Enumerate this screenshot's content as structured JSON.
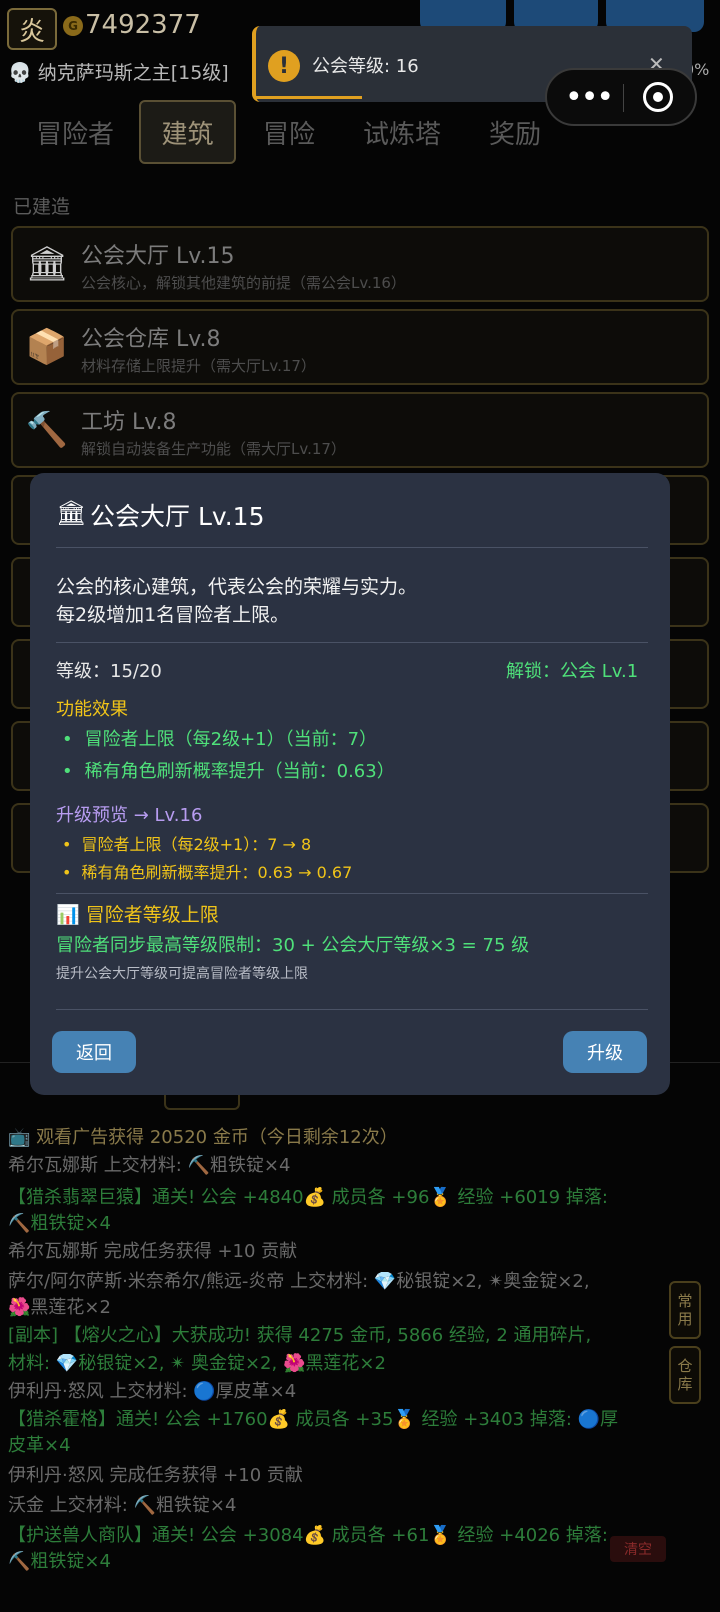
{
  "header": {
    "badge": "炎",
    "gold_icon": "G",
    "gold": "7492377",
    "player": "💀 纳克萨玛斯之主[15级]",
    "percent": "0%"
  },
  "toast": {
    "icon": "!",
    "text": "公会等级: 16",
    "close": "✕"
  },
  "capsule": {
    "more": "•••"
  },
  "tabs": [
    "冒险者",
    "建筑",
    "冒险",
    "试炼塔",
    "奖励"
  ],
  "built_label": "已建造",
  "buildings": [
    {
      "icon": "🏛",
      "title": "公会大厅  Lv.15",
      "desc": "公会核心，解锁其他建筑的前提（需公会Lv.16）"
    },
    {
      "icon": "📦",
      "title": "公会仓库  Lv.8",
      "desc": "材料存储上限提升（需大厅Lv.17）"
    },
    {
      "icon": "🔨",
      "title": "工坊  Lv.8",
      "desc": "解锁自动装备生产功能（需大厅Lv.17）"
    }
  ],
  "modal": {
    "icon": "🏛",
    "title": "公会大厅  Lv.15",
    "desc1": "公会的核心建筑，代表公会的荣耀与实力。",
    "desc2": "每2级增加1名冒险者上限。",
    "level": "等级：15/20",
    "unlock": "解锁：公会 Lv.1",
    "func_title": "功能效果",
    "effects": [
      "冒险者上限（每2级+1）（当前：7）",
      "稀有角色刷新概率提升（当前：0.63）"
    ],
    "upgrade_title": "升级预览 → Lv.16",
    "upgrades": [
      "冒险者上限（每2级+1）：7 → 8",
      "稀有角色刷新概率提升：0.63 → 0.67"
    ],
    "cap_icon": "📊",
    "cap_title": "冒险者等级上限",
    "cap_line": "冒险者同步最高等级限制：30 + 公会大厅等级×3 = 75 级",
    "cap_hint": "提升公会大厅等级可提高冒险者等级上限",
    "back": "返回",
    "upgrade": "升级"
  },
  "logs": [
    "📺 观看广告获得 20520 金币（今日剩余12次）",
    "希尔瓦娜斯 上交材料: ⛏️粗铁锭×4",
    "【猎杀翡翠巨猿】通关! 公会 +4840💰 成员各 +96🏅 经验 +6019 掉落:",
    "⛏️粗铁锭×4",
    "希尔瓦娜斯 完成任务获得 +10 贡献",
    "萨尔/阿尔萨斯·米奈希尔/熊远-炎帝 上交材料: 💎秘银锭×2, ✴奥金锭×2,",
    "🌺黑莲花×2",
    "[副本] 【熔火之心】大获成功! 获得 4275 金币, 5866 经验, 2 通用碎片,",
    "材料: 💎秘银锭×2, ✴ 奥金锭×2, 🌺黑莲花×2",
    "伊利丹·怒风 上交材料: 🔵厚皮革×4",
    "【猎杀霍格】通关! 公会 +1760💰 成员各 +35🏅 经验 +3403 掉落: 🔵厚",
    "皮革×4",
    "伊利丹·怒风 完成任务获得 +10 贡献",
    "沃金 上交材料: ⛏️粗铁锭×4",
    "【护送兽人商队】通关! 公会 +3084💰 成员各 +61🏅 经验 +4026 掉落:",
    "⛏️粗铁锭×4"
  ],
  "side_buttons": [
    "常用",
    "仓库"
  ],
  "clear": "清空"
}
